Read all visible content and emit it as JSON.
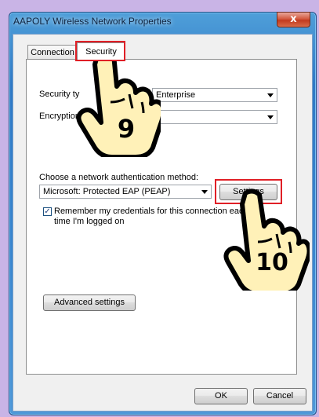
{
  "window": {
    "title": "AAPOLY Wireless Network Properties",
    "close_glyph": "x"
  },
  "tabs": [
    {
      "label": "Connection"
    },
    {
      "label": "Security"
    }
  ],
  "security": {
    "security_type_label": "Security ty",
    "security_type_value": "Enterprise",
    "encryption_type_label": "Encryption t",
    "encryption_type_value": "",
    "auth_method_label": "Choose a network authentication method:",
    "auth_method_value": "Microsoft: Protected EAP (PEAP)",
    "settings_button": "Settings",
    "remember_label_line1": "Remember my credentials for this connection eac",
    "remember_label_line2": "time I'm logged on",
    "remember_checked": true,
    "advanced_button": "Advanced settings"
  },
  "footer": {
    "ok_button": "OK",
    "cancel_button": "Cancel"
  },
  "annotations": {
    "step_a": "9",
    "step_b": "10",
    "highlight_color": "#e01f26"
  }
}
